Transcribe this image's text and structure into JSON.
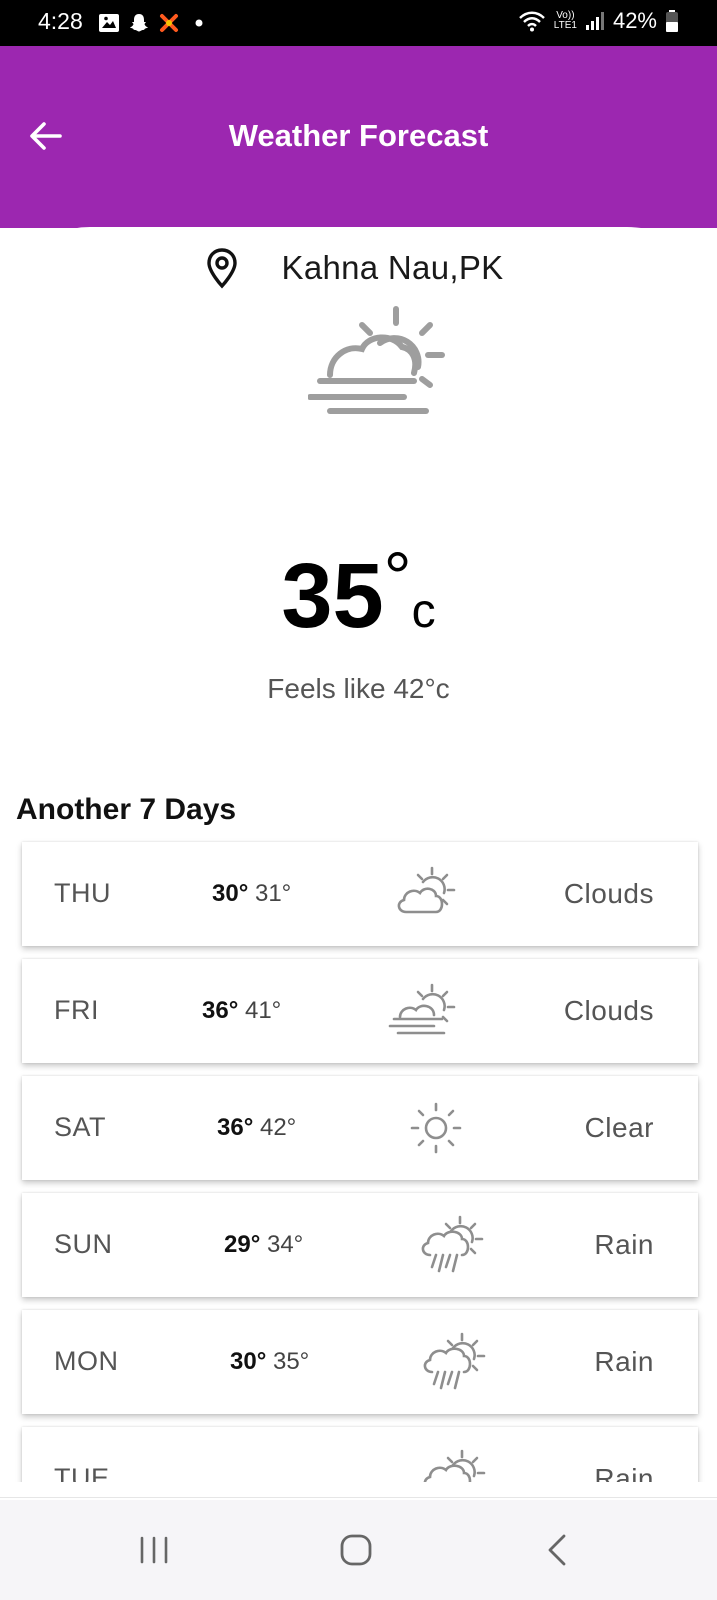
{
  "status_bar": {
    "time": "4:28",
    "battery": "42%",
    "network_top": "Vo))",
    "network_bottom": "LTE1"
  },
  "app_bar": {
    "title": "Weather Forecast",
    "background": "#9c27b0"
  },
  "location": {
    "name": "Kahna Nau,PK"
  },
  "current": {
    "icon": "partly-cloudy-haze-icon",
    "temp": "35",
    "unit_degree": "°",
    "unit": "c",
    "feels_like": "Feels like 42°c"
  },
  "forecast": {
    "title": "Another 7 Days",
    "days": [
      {
        "day": "THU",
        "high": "30°",
        "low": "31°",
        "condition": "Clouds",
        "icon": "partly-cloudy-icon"
      },
      {
        "day": "FRI",
        "high": "36°",
        "low": "41°",
        "condition": "Clouds",
        "icon": "cloudy-haze-icon"
      },
      {
        "day": "SAT",
        "high": "36°",
        "low": "42°",
        "condition": "Clear",
        "icon": "sun-icon"
      },
      {
        "day": "SUN",
        "high": "29°",
        "low": "34°",
        "condition": "Rain",
        "icon": "rain-sun-icon"
      },
      {
        "day": "MON",
        "high": "30°",
        "low": "35°",
        "condition": "Rain",
        "icon": "rain-sun-icon"
      },
      {
        "day": "TUE",
        "high": "",
        "low": "",
        "condition": "Rain",
        "icon": "rain-sun-icon"
      }
    ]
  }
}
